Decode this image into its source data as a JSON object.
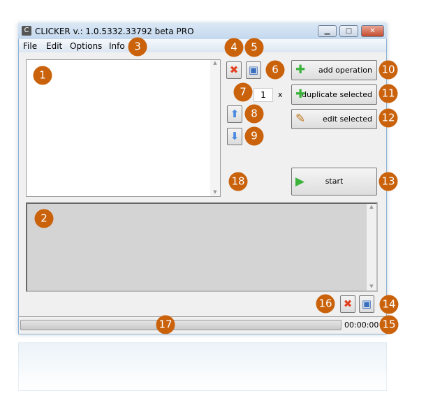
{
  "window": {
    "title": "CLICKER v.: 1.0.5332.33792 beta  PRO",
    "minimize": "▁",
    "maximize": "□",
    "close": "✕"
  },
  "menu": [
    "File",
    "Edit",
    "Options",
    "Info"
  ],
  "toolbar": {
    "repeat_count": "1",
    "repeat_suffix": "x"
  },
  "buttons": {
    "add_operation": "add operation",
    "duplicate_selected": "duplicate selected",
    "edit_selected": "edit selected",
    "start": "start"
  },
  "status": {
    "time": "00:00:00",
    "progress": 0
  },
  "callouts": [
    "1",
    "2",
    "3",
    "4",
    "5",
    "6",
    "7",
    "8",
    "9",
    "10",
    "11",
    "12",
    "13",
    "14",
    "15",
    "16",
    "17",
    "18"
  ],
  "colors": {
    "callout": "#c9620b",
    "delete": "#e04020",
    "save": "#3a6fc0",
    "up_down": "#4a8ae0",
    "add": "#3cb43c"
  }
}
